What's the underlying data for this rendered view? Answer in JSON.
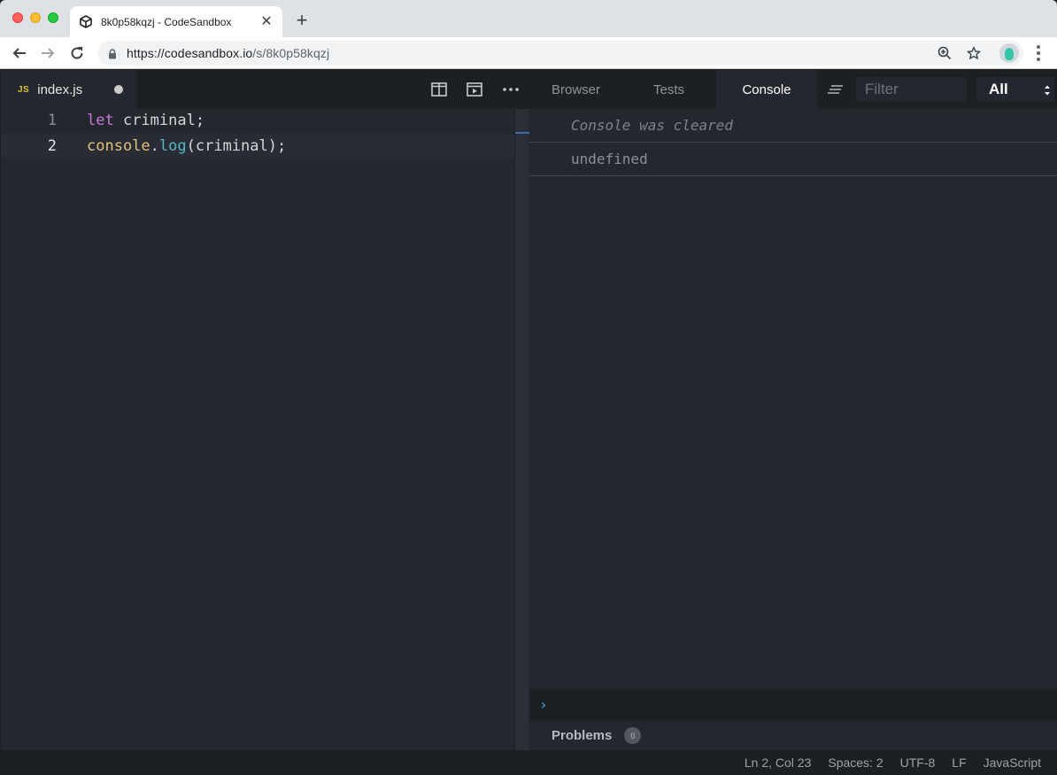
{
  "browser": {
    "tab_title": "8k0p58kqzj - CodeSandbox",
    "tab_close": "✕",
    "new_tab": "+",
    "url_host": "https://codesandbox.io",
    "url_path": "/s/8k0p58kqzj"
  },
  "editor": {
    "file_badge": "JS",
    "file_name": "index.js",
    "lines": [
      {
        "number": "1"
      },
      {
        "number": "2"
      }
    ],
    "code": {
      "line1_kw": "let",
      "line1_rest": " criminal;",
      "line2_obj": "console",
      "line2_dot": ".",
      "line2_fn": "log",
      "line2_rest": "(criminal);"
    }
  },
  "preview": {
    "tabs": [
      {
        "label": "Browser"
      },
      {
        "label": "Tests"
      },
      {
        "label": "Console"
      }
    ],
    "active_tab": "Console",
    "filter_placeholder": "Filter",
    "level_value": "All"
  },
  "console": {
    "entries": [
      {
        "text": "Console was cleared",
        "kind": "cleared"
      },
      {
        "text": "undefined",
        "kind": "log"
      }
    ],
    "prompt": "›"
  },
  "problems": {
    "label": "Problems",
    "count": "0"
  },
  "status": {
    "cursor": "Ln 2, Col 23",
    "indent": "Spaces: 2",
    "encoding": "UTF-8",
    "eol": "LF",
    "language": "JavaScript"
  },
  "colors": {
    "keyword": "#c678dd",
    "object": "#e5c07b",
    "function": "#56b6c2",
    "js_badge": "#dbc32b",
    "prompt": "#40a9f3"
  }
}
